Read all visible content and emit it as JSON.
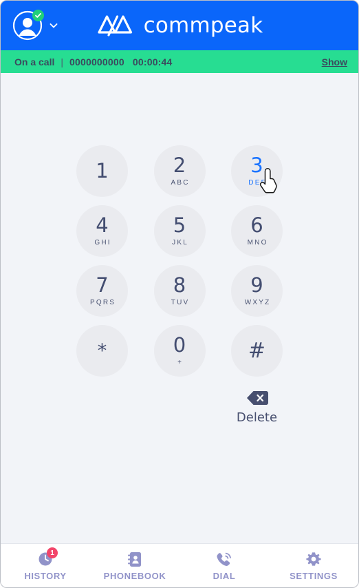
{
  "window": {
    "background": "#f2f4f8",
    "border_color": "#bcbfc6"
  },
  "header": {
    "background": "#0a66fa",
    "brand": "commpeak",
    "logo_icon": "commpeak-peaks-logo",
    "account_icon": "user-avatar-icon",
    "status_icon": "online-check-badge-icon",
    "dropdown_icon": "chevron-down-icon",
    "status_color": "#21d07a"
  },
  "call_bar": {
    "background": "#27dd92",
    "text_color": "#3b4a5e",
    "status": "On a call",
    "separator": "|",
    "number": "0000000000",
    "timer": "00:00:44",
    "show_label": "Show"
  },
  "keypad": {
    "hovered_key": "3",
    "hover_color": "#1a73ff",
    "key_background": "#eaebef",
    "key_text_color": "#434d70",
    "cursor_icon": "hand-pointer-cursor",
    "rows": [
      [
        {
          "digit": "1",
          "letters": ""
        },
        {
          "digit": "2",
          "letters": "ABC"
        },
        {
          "digit": "3",
          "letters": "DEF"
        }
      ],
      [
        {
          "digit": "4",
          "letters": "GHI"
        },
        {
          "digit": "5",
          "letters": "JKL"
        },
        {
          "digit": "6",
          "letters": "MNO"
        }
      ],
      [
        {
          "digit": "7",
          "letters": "PQRS"
        },
        {
          "digit": "8",
          "letters": "TUV"
        },
        {
          "digit": "9",
          "letters": "WXYZ"
        }
      ],
      [
        {
          "digit": "*",
          "letters": ""
        },
        {
          "digit": "0",
          "letters": "+"
        },
        {
          "digit": "#",
          "letters": ""
        }
      ]
    ]
  },
  "delete": {
    "label": "Delete",
    "icon": "backspace-delete-icon",
    "icon_color": "#474f6f"
  },
  "tabbar": {
    "background": "#ffffff",
    "item_color": "#9193c9",
    "badge_color": "#f2456a",
    "items": [
      {
        "label": "HISTORY",
        "icon": "clock-history-icon",
        "badge": "1"
      },
      {
        "label": "PHONEBOOK",
        "icon": "contact-book-icon",
        "badge": ""
      },
      {
        "label": "DIAL",
        "icon": "phone-ringing-icon",
        "badge": ""
      },
      {
        "label": "SETTINGS",
        "icon": "gear-icon",
        "badge": ""
      }
    ]
  }
}
